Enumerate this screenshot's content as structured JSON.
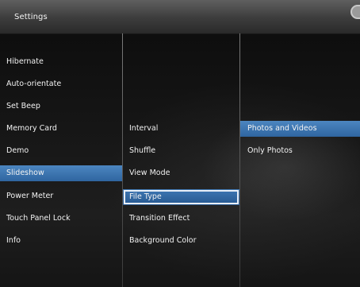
{
  "title_bar": {
    "title": "Settings"
  },
  "menu": {
    "items": [
      {
        "label": "Hibernate"
      },
      {
        "label": "Auto-orientate"
      },
      {
        "label": "Set Beep"
      },
      {
        "label": "Memory Card"
      },
      {
        "label": "Demo"
      },
      {
        "label": "Slideshow",
        "selected": true
      },
      {
        "label": "Power Meter"
      },
      {
        "label": "Touch Panel Lock"
      },
      {
        "label": "Info"
      }
    ]
  },
  "slideshow_menu": {
    "items": [
      {
        "label": "Interval"
      },
      {
        "label": "Shuffle"
      },
      {
        "label": "View Mode"
      },
      {
        "label": "File Type",
        "focused": true
      },
      {
        "label": "Transition Effect"
      },
      {
        "label": "Background Color"
      }
    ]
  },
  "file_type_options": {
    "items": [
      {
        "label": "Photos and Videos",
        "selected": true
      },
      {
        "label": "Only Photos"
      }
    ]
  },
  "colors": {
    "selection": "#3a72ae",
    "title_bar": "#4a4a4a",
    "text": "#f2f2f2"
  }
}
